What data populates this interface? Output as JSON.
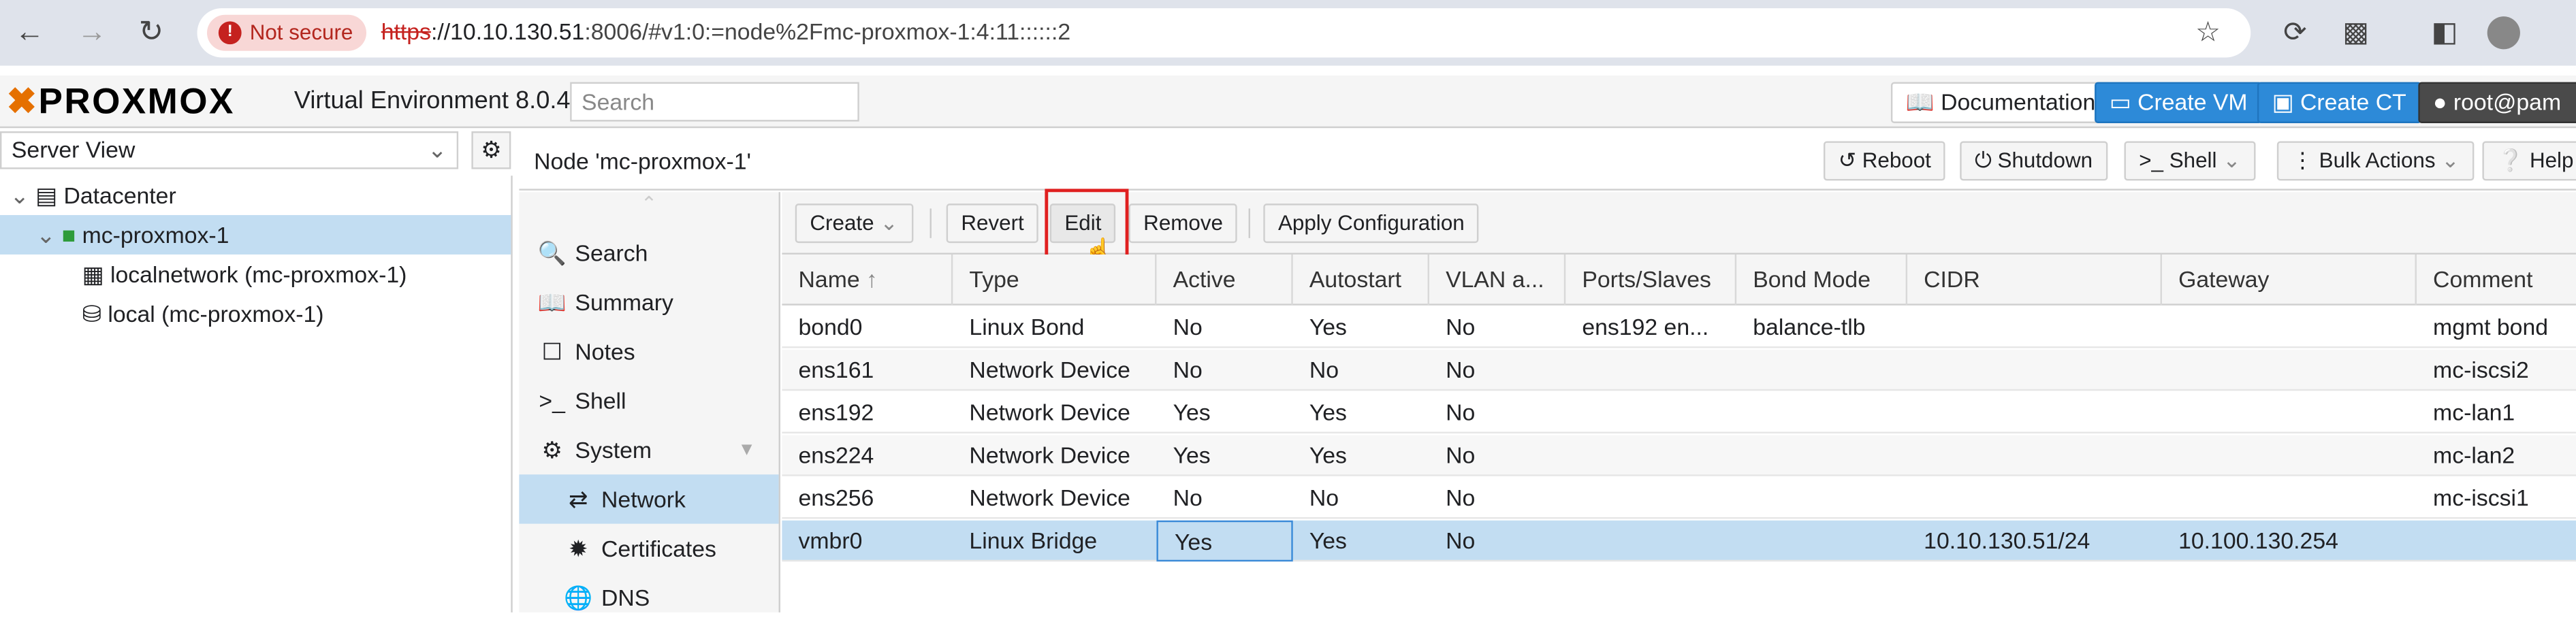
{
  "browser": {
    "not_secure": "Not secure",
    "url_scheme": "https",
    "url_host": "://10.10.130.51",
    "url_rest": ":8006/#v1:0:=node%2Fmc-proxmox-1:4:11::::::2"
  },
  "header": {
    "logo": "PROXMOX",
    "version": "Virtual Environment 8.0.4",
    "search_placeholder": "Search",
    "documentation": "Documentation",
    "create_vm": "Create VM",
    "create_ct": "Create CT",
    "user": "root@pam"
  },
  "tree": {
    "view": "Server View",
    "items": [
      "Datacenter",
      "mc-proxmox-1",
      "localnetwork (mc-proxmox-1)",
      "local (mc-proxmox-1)"
    ]
  },
  "node": {
    "title": "Node 'mc-proxmox-1'",
    "reboot": "Reboot",
    "shutdown": "Shutdown",
    "shell": "Shell",
    "bulk_actions": "Bulk Actions",
    "help": "Help"
  },
  "menu": [
    "Search",
    "Summary",
    "Notes",
    "Shell",
    "System",
    "Network",
    "Certificates",
    "DNS"
  ],
  "grid_toolbar": {
    "create": "Create",
    "revert": "Revert",
    "edit": "Edit",
    "remove": "Remove",
    "apply": "Apply Configuration"
  },
  "columns": [
    "Name",
    "Type",
    "Active",
    "Autostart",
    "VLAN a...",
    "Ports/Slaves",
    "Bond Mode",
    "CIDR",
    "Gateway",
    "Comment"
  ],
  "rows": [
    [
      "bond0",
      "Linux Bond",
      "No",
      "Yes",
      "No",
      "ens192 en...",
      "balance-tlb",
      "",
      "",
      "mgmt bond"
    ],
    [
      "ens161",
      "Network Device",
      "No",
      "No",
      "No",
      "",
      "",
      "",
      "",
      "mc-iscsi2"
    ],
    [
      "ens192",
      "Network Device",
      "Yes",
      "Yes",
      "No",
      "",
      "",
      "",
      "",
      "mc-lan1"
    ],
    [
      "ens224",
      "Network Device",
      "Yes",
      "Yes",
      "No",
      "",
      "",
      "",
      "",
      "mc-lan2"
    ],
    [
      "ens256",
      "Network Device",
      "No",
      "No",
      "No",
      "",
      "",
      "",
      "",
      "mc-iscsi1"
    ],
    [
      "vmbr0",
      "Linux Bridge",
      "Yes",
      "Yes",
      "No",
      "",
      "",
      "10.10.130.51/24",
      "10.100.130.254",
      ""
    ]
  ]
}
